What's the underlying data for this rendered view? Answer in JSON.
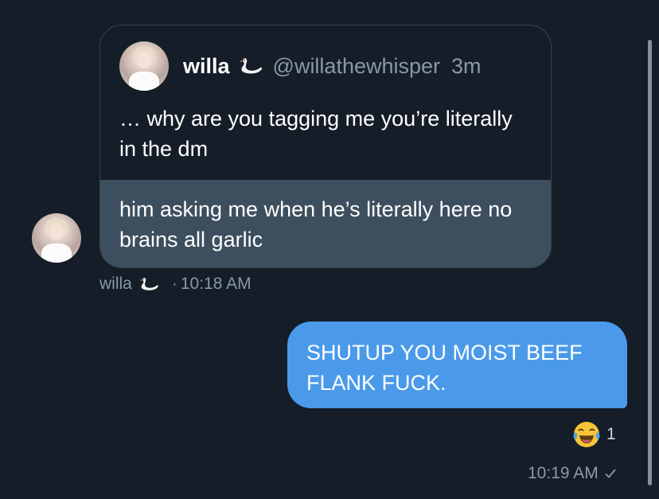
{
  "quote": {
    "author_name": "willa",
    "author_handle": "@willathewhisper",
    "time_ago": "3m",
    "text": "… why are you tagging me you’re literally in the dm"
  },
  "received_message": {
    "text": "him asking me when he’s literally here no brains all garlic",
    "sender_name": "willa",
    "dot": "·",
    "time": "10:18 AM"
  },
  "sent_message": {
    "text": "SHUTUP YOU MOIST BEEF FLANK FUCK.",
    "reaction_count": "1",
    "time": "10:19 AM"
  },
  "icons": {
    "swan": "swan-emoji",
    "reaction": "face-with-tears-of-joy",
    "read_receipt": "checkmark"
  },
  "colors": {
    "background": "#151d28",
    "sent_bubble": "#4a9ae9",
    "received_bubble": "#3d4f5e",
    "secondary_text": "#8899a6"
  }
}
